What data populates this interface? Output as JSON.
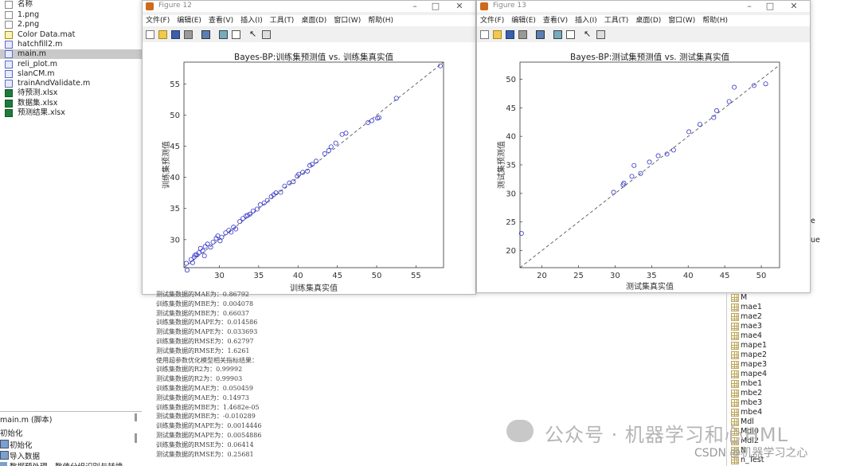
{
  "files": {
    "header": "名称",
    "items": [
      {
        "name": "1.png",
        "type": "png"
      },
      {
        "name": "2.png",
        "type": "png"
      },
      {
        "name": "Color Data.mat",
        "type": "mat"
      },
      {
        "name": "hatchfill2.m",
        "type": "m"
      },
      {
        "name": "main.m",
        "type": "m",
        "selected": true
      },
      {
        "name": "reli_plot.m",
        "type": "m"
      },
      {
        "name": "slanCM.m",
        "type": "m"
      },
      {
        "name": "trainAndValidate.m",
        "type": "m"
      },
      {
        "name": "待预测.xlsx",
        "type": "xlsx"
      },
      {
        "name": "数据集.xlsx",
        "type": "xlsx"
      },
      {
        "name": "预测结果.xlsx",
        "type": "xlsx"
      }
    ]
  },
  "menu": [
    "文件(F)",
    "编辑(E)",
    "查看(V)",
    "插入(I)",
    "工具(T)",
    "桌面(D)",
    "窗口(W)",
    "帮助(H)"
  ],
  "figure12": {
    "window_title": "Figure 12",
    "chart_data": {
      "type": "scatter",
      "title": "Bayes-BP:训练集预测值 vs. 训练集真实值",
      "xlabel": "训练集真实值",
      "ylabel": "训练集预测值",
      "xlim": [
        25.5,
        58.5
      ],
      "ylim": [
        25.5,
        58.5
      ],
      "xticks": [
        30,
        35,
        40,
        45,
        50,
        55
      ],
      "yticks": [
        30,
        35,
        40,
        45,
        50,
        55
      ],
      "reference_line": "y = x (dashed)",
      "color": "#3333cc",
      "points": [
        [
          25.8,
          26.2
        ],
        [
          26.4,
          26.8
        ],
        [
          26.6,
          26.3
        ],
        [
          26.8,
          27.2
        ],
        [
          27.1,
          27.6
        ],
        [
          27.4,
          27.9
        ],
        [
          27.6,
          28.6
        ],
        [
          27.9,
          28.2
        ],
        [
          28.2,
          28.9
        ],
        [
          28.5,
          29.3
        ],
        [
          28.9,
          28.8
        ],
        [
          29.2,
          29.6
        ],
        [
          29.6,
          30.2
        ],
        [
          30.1,
          29.8
        ],
        [
          30.3,
          30.4
        ],
        [
          30.8,
          31.1
        ],
        [
          31.2,
          31.5
        ],
        [
          31.8,
          32.0
        ],
        [
          32.1,
          31.7
        ],
        [
          32.6,
          32.9
        ],
        [
          33.0,
          33.4
        ],
        [
          33.4,
          33.8
        ],
        [
          33.9,
          34.1
        ],
        [
          34.3,
          34.6
        ],
        [
          34.8,
          34.9
        ],
        [
          35.2,
          35.6
        ],
        [
          35.7,
          35.9
        ],
        [
          36.1,
          36.3
        ],
        [
          36.6,
          36.9
        ],
        [
          37.2,
          37.5
        ],
        [
          37.8,
          37.6
        ],
        [
          38.3,
          38.6
        ],
        [
          38.9,
          39.1
        ],
        [
          39.4,
          39.3
        ],
        [
          39.9,
          40.2
        ],
        [
          40.6,
          40.8
        ],
        [
          41.2,
          41.0
        ],
        [
          41.8,
          42.1
        ],
        [
          42.3,
          42.6
        ],
        [
          43.4,
          43.8
        ],
        [
          44.2,
          44.9
        ],
        [
          44.8,
          45.5
        ],
        [
          45.6,
          46.9
        ],
        [
          46.1,
          47.1
        ],
        [
          48.9,
          48.8
        ],
        [
          49.4,
          49.1
        ],
        [
          50.3,
          49.6
        ],
        [
          52.5,
          52.7
        ],
        [
          58.1,
          57.9
        ],
        [
          25.9,
          25.1
        ],
        [
          26.9,
          27.5
        ],
        [
          28.1,
          27.4
        ],
        [
          29.8,
          30.6
        ],
        [
          31.5,
          31.2
        ],
        [
          33.6,
          33.9
        ],
        [
          36.9,
          37.2
        ],
        [
          40.1,
          40.5
        ],
        [
          41.5,
          41.9
        ],
        [
          43.9,
          44.3
        ],
        [
          50.1,
          49.5
        ]
      ]
    }
  },
  "figure13": {
    "window_title": "Figure 13",
    "chart_data": {
      "type": "scatter",
      "title": "Bayes-BP:测试集预测值 vs. 测试集真实值",
      "xlabel": "测试集真实值",
      "ylabel": "测试集预测值",
      "xlim": [
        17,
        52.5
      ],
      "ylim": [
        17,
        53
      ],
      "xticks": [
        20,
        25,
        30,
        35,
        40,
        45,
        50
      ],
      "yticks": [
        20,
        25,
        30,
        35,
        40,
        45,
        50
      ],
      "reference_line": "y = x (dashed)",
      "color": "#3333cc",
      "points": [
        [
          17.2,
          23.0
        ],
        [
          29.8,
          30.2
        ],
        [
          31.1,
          31.5
        ],
        [
          31.2,
          31.8
        ],
        [
          32.3,
          33.0
        ],
        [
          32.6,
          34.9
        ],
        [
          33.5,
          33.5
        ],
        [
          34.7,
          35.5
        ],
        [
          35.9,
          36.6
        ],
        [
          37.1,
          36.9
        ],
        [
          38.0,
          37.6
        ],
        [
          40.1,
          40.8
        ],
        [
          41.6,
          42.1
        ],
        [
          43.5,
          43.3
        ],
        [
          43.9,
          44.5
        ],
        [
          45.6,
          46.1
        ],
        [
          46.3,
          48.6
        ],
        [
          49.0,
          48.9
        ],
        [
          50.6,
          49.2
        ]
      ]
    }
  },
  "console": {
    "lines": [
      "测试集数据的MAE为：0.86792",
      "训练集数据的MBE为：0.004078",
      "测试集数据的MBE为：0.66037",
      "训练集数据的MAPE为：0.014586",
      "测试集数据的MAPE为：0.033693",
      "训练集数据的RMSE为：0.62797",
      "测试集数据的RMSE为：1.6261",
      "使用超参数优化模型相关指标结果：",
      "训练集数据的R2为：0.99992",
      "测试集数据的R2为：0.99903",
      "训练集数据的MAE为：0.050459",
      "测试集数据的MAE为：0.14973",
      "训练集数据的MBE为：1.4682e-05",
      "测试集数据的MBE为：-0.010289",
      "训练集数据的MAPE为：0.0014446",
      "测试集数据的MAPE为：0.0054886",
      "训练集数据的RMSE为：0.06414",
      "测试集数据的RMSE为：0.25681"
    ]
  },
  "workspace": {
    "items": [
      "M",
      "mae1",
      "mae2",
      "mae3",
      "mae4",
      "mape1",
      "mape2",
      "mape3",
      "mape4",
      "mbe1",
      "mbe2",
      "mbe3",
      "mbe4",
      "Mdl",
      "Mdl0",
      "Mdl2",
      "N",
      "n_Test"
    ],
    "partial_right": [
      "e",
      "ue"
    ]
  },
  "details": {
    "title": "main.m  (脚本)",
    "sections": [
      "初始化",
      "导入数据",
      "数据预处理 - 数值分组识别与转换"
    ]
  },
  "watermark": {
    "text": "公众号 · 机器学习和心HML",
    "csdn": "CSDN @机器学习之心"
  }
}
